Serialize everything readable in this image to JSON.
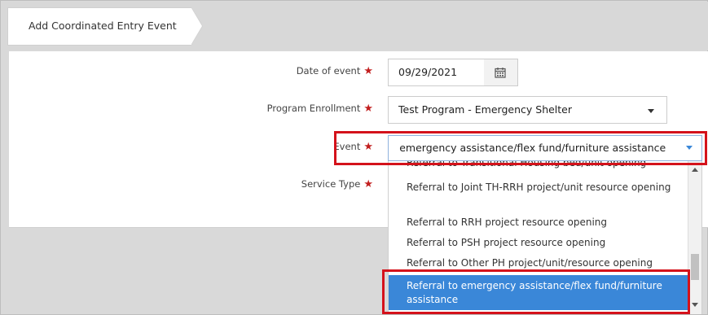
{
  "tab": {
    "title": "Add Coordinated Entry Event"
  },
  "form": {
    "date_label": "Date of event",
    "date_value": "09/29/2021",
    "program_label": "Program Enrollment",
    "program_value": "Test Program - Emergency Shelter",
    "event_label": "Event",
    "event_value": "  emergency assistance/flex fund/furniture assistance",
    "service_label": "Service Type",
    "required_mark": "★"
  },
  "dropdown": {
    "options": [
      "Referral to Transitional Housing bed/unit opening",
      "Referral to Joint TH-RRH project/unit resource opening",
      "Referral to RRH project resource opening",
      "Referral to PSH project resource opening",
      "Referral to Other PH project/unit/resource opening",
      "Referral to emergency assistance/flex fund/furniture assistance"
    ],
    "selected_index": 5
  },
  "colors": {
    "required": "#c21f1f",
    "highlight_box": "#d4121b",
    "selected_option": "#3a87d8",
    "select_caret": "#3a87d8"
  },
  "icons": {
    "calendar": "calendar-icon",
    "caret": "chevron-down-icon"
  }
}
